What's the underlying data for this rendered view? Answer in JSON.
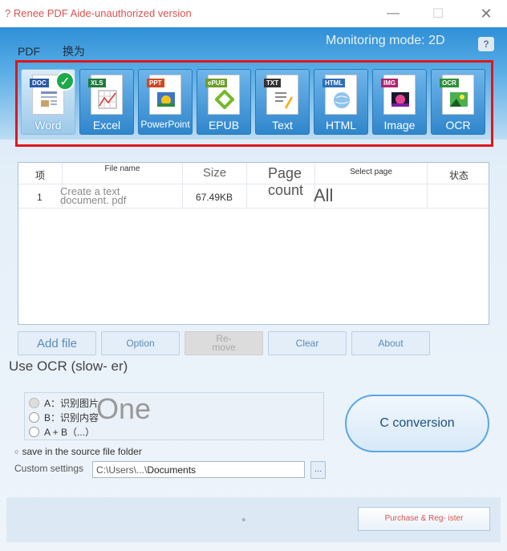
{
  "window": {
    "title": "? Renee PDF Aide-unauthorized version",
    "minimize": "—",
    "maximize": "☐",
    "close": "✕"
  },
  "header": {
    "monitoring_mode": "Monitoring mode: 2D",
    "help": "?",
    "convert_label_prefix": "PDF",
    "convert_label_suffix": "换为"
  },
  "formats": [
    {
      "tag": "DOC",
      "label": "Word",
      "tag_color": "#2b5aa8",
      "active": true
    },
    {
      "tag": "XLS",
      "label": "Excel",
      "tag_color": "#1e7a3c",
      "active": false
    },
    {
      "tag": "PPT",
      "label": "PowerPoint",
      "tag_color": "#d04a24",
      "active": false
    },
    {
      "tag": "ePUB",
      "label": "EPUB",
      "tag_color": "#6f9d2a",
      "active": false
    },
    {
      "tag": "TXT",
      "label": "Text",
      "tag_color": "#333333",
      "active": false
    },
    {
      "tag": "HTML",
      "label": "HTML",
      "tag_color": "#2e6fb5",
      "active": false
    },
    {
      "tag": "IMG",
      "label": "Image",
      "tag_color": "#b0226e",
      "active": false
    },
    {
      "tag": "OCR",
      "label": "OCR",
      "tag_color": "#2f8f3a",
      "active": false
    }
  ],
  "table": {
    "headers": {
      "index": "项",
      "file_name": "File name",
      "size": "Size",
      "page_count": "Page count",
      "select_page": "Select page",
      "status": "状态"
    },
    "rows": [
      {
        "index": "1",
        "file_name": "Create a text document. pdf",
        "size": "67.49KB",
        "page_count": "",
        "select_page": "All",
        "status": ""
      }
    ]
  },
  "actions": {
    "add_file": "Add file",
    "option": "Option",
    "remove": "Re- move",
    "clear": "Clear",
    "about": "About"
  },
  "ocr": {
    "label": "Use OCR (slow- er)",
    "option_a": "A：识别图片",
    "option_b": "B：识别内容",
    "option_ab": "A + B（...）",
    "one": "One"
  },
  "convert_button": "C conversion",
  "output": {
    "save_source": "save in the source file folder",
    "custom_settings": "Custom settings",
    "path_prefix": "C:\\Users\\...\\",
    "path_value": "Documents",
    "browse": "..."
  },
  "footer": {
    "purchase": "Purchase & Reg- ister",
    "dot": "。"
  }
}
